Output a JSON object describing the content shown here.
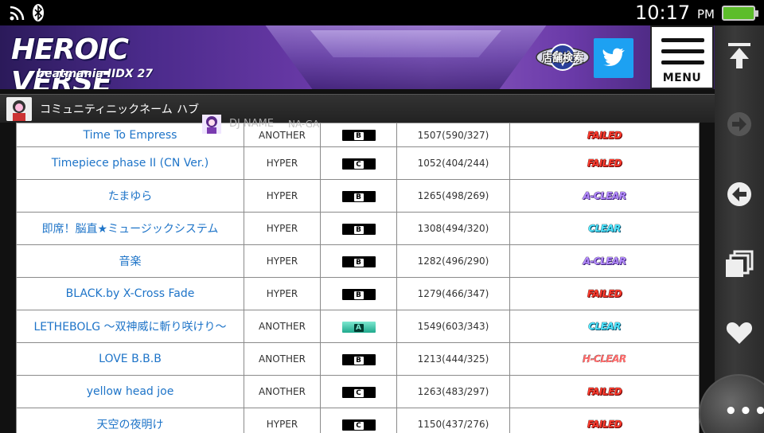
{
  "status_bar": {
    "time": "10:17",
    "ampm": "PM"
  },
  "banner": {
    "logo_main": "HEROIC VERSE",
    "logo_sub": "beatmania IIDX 27",
    "shop_search_label": "店舗検索",
    "menu_label": "MENU"
  },
  "community": {
    "label": "コミュニティニックネーム",
    "value": "ハブ"
  },
  "dj": {
    "label": "DJ NAME",
    "value": "NA-GA"
  },
  "table": {
    "rows": [
      {
        "title": "Time To Empress",
        "difficulty": "ANOTHER",
        "grade": "B",
        "score": "1507(590/327)",
        "lamp": "FAILED",
        "lamp_class": "lamp-failed"
      },
      {
        "title": "Timepiece phase II (CN Ver.)",
        "difficulty": "HYPER",
        "grade": "C",
        "score": "1052(404/244)",
        "lamp": "FAILED",
        "lamp_class": "lamp-failed"
      },
      {
        "title": "たまゆら",
        "difficulty": "HYPER",
        "grade": "B",
        "score": "1265(498/269)",
        "lamp": "A-CLEAR",
        "lamp_class": "lamp-aclear"
      },
      {
        "title": "即席！脳直★ミュージックシステム",
        "difficulty": "HYPER",
        "grade": "B",
        "score": "1308(494/320)",
        "lamp": "CLEAR",
        "lamp_class": "lamp-clear"
      },
      {
        "title": "音楽",
        "difficulty": "HYPER",
        "grade": "B",
        "score": "1282(496/290)",
        "lamp": "A-CLEAR",
        "lamp_class": "lamp-aclear"
      },
      {
        "title": "BLACK.by X-Cross Fade",
        "difficulty": "HYPER",
        "grade": "B",
        "score": "1279(466/347)",
        "lamp": "FAILED",
        "lamp_class": "lamp-failed"
      },
      {
        "title": "LETHEBOLG ～双神威に斬り咲けり～",
        "difficulty": "ANOTHER",
        "grade": "A",
        "score": "1549(603/343)",
        "lamp": "CLEAR",
        "lamp_class": "lamp-clear"
      },
      {
        "title": "LOVE B.B.B",
        "difficulty": "ANOTHER",
        "grade": "B",
        "score": "1213(444/325)",
        "lamp": "H-CLEAR",
        "lamp_class": "lamp-hclear"
      },
      {
        "title": "yellow head joe",
        "difficulty": "ANOTHER",
        "grade": "C",
        "score": "1263(483/297)",
        "lamp": "FAILED",
        "lamp_class": "lamp-failed"
      },
      {
        "title": "天空の夜明け",
        "difficulty": "HYPER",
        "grade": "C",
        "score": "1150(437/276)",
        "lamp": "FAILED",
        "lamp_class": "lamp-failed"
      }
    ]
  },
  "side_panel": {
    "icons": [
      "scroll-top-icon",
      "forward-icon",
      "back-icon",
      "tabs-icon",
      "bookmark-heart-icon"
    ],
    "more_icon": "more-options-icon"
  },
  "colors": {
    "banner_purple": "#6a3aa8",
    "link_blue": "#1e74c8",
    "failed_red": "#ff3c2e",
    "aclear_purple": "#b58cff",
    "clear_cyan": "#4fe6ff",
    "twitter_blue": "#1da1f2"
  }
}
